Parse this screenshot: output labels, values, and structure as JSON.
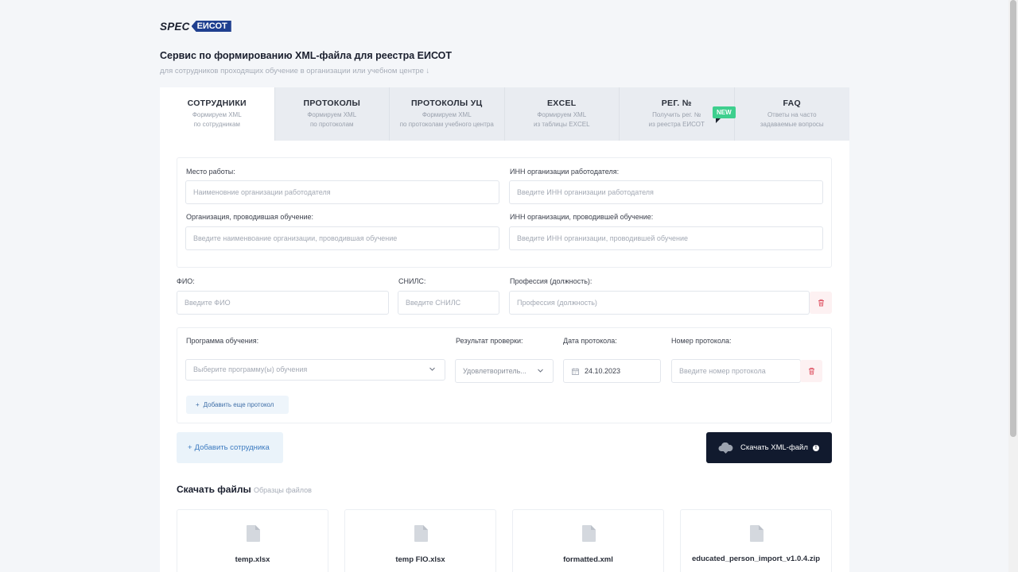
{
  "logo": {
    "spec": "SPEC",
    "eisot": "ЕИСОТ"
  },
  "header": {
    "title": "Сервис по формированию XML-файла для реестра ЕИСОТ",
    "subtitle": "для сотрудников проходящих обучение в организации или учебном центре ↓"
  },
  "tabs": [
    {
      "title": "СОТРУДНИКИ",
      "desc": "Формируем XML\nпо сотрудникам",
      "active": true
    },
    {
      "title": "ПРОТОКОЛЫ",
      "desc": "Формируем XML\nпо протоколам"
    },
    {
      "title": "ПРОТОКОЛЫ УЦ",
      "desc": "Формируем XML\nпо протоколам учебного центра"
    },
    {
      "title": "EXCEL",
      "desc": "Формируем XML\nиз таблицы EXCEL"
    },
    {
      "title": "РЕГ. №",
      "desc": "Получить рег. №\nиз реестра ЕИСОТ",
      "badge": "NEW"
    },
    {
      "title": "FAQ",
      "desc": "Ответы на часто\nзадаваемые вопросы"
    }
  ],
  "org": {
    "workplace_label": "Место работы:",
    "workplace_placeholder": "Наименовние организации работодателя",
    "employer_inn_label": "ИНН организации работодателя:",
    "employer_inn_placeholder": "Введите ИНН организации работодателя",
    "trainer_org_label": "Организация, проводившая обучение:",
    "trainer_org_placeholder": "Введите наименвоание организации, проводившая обучение",
    "trainer_inn_label": "ИНН организации, проводившей обучение:",
    "trainer_inn_placeholder": "Введите ИНН организации, проводившей обучение"
  },
  "employee": {
    "fio_label": "ФИО:",
    "fio_placeholder": "Введите ФИО",
    "snils_label": "СНИЛС:",
    "snils_placeholder": "Введите СНИЛС",
    "profession_label": "Профессия (должность):",
    "profession_placeholder": "Профессия (должность)"
  },
  "protocol": {
    "program_label": "Программа обучения:",
    "program_placeholder": "Выберите программу(ы) обучения",
    "result_label": "Результат проверки:",
    "result_value": "Удовлетворитель...",
    "date_label": "Дата протокола:",
    "date_value": "24.10.2023",
    "number_label": "Номер протокола:",
    "number_placeholder": "Введите номер протокола",
    "add_protocol": "Добавить еще протокол"
  },
  "actions": {
    "add_employee": "Добавить сотрудника",
    "download_xml": "Скачать XML-файл"
  },
  "files": {
    "title": "Скачать файлы",
    "subtitle": "Образцы файлов",
    "items": [
      {
        "name": "temp.xlsx"
      },
      {
        "name": "temp FIO.xlsx"
      },
      {
        "name": "formatted.xml"
      },
      {
        "name": "educated_person_import_v1.0.4.zip"
      }
    ]
  },
  "colors": {
    "accent": "#3d7bc0",
    "dark_button": "#111a2e",
    "new_badge": "#3ecf8e",
    "danger": "#e05a6a"
  }
}
